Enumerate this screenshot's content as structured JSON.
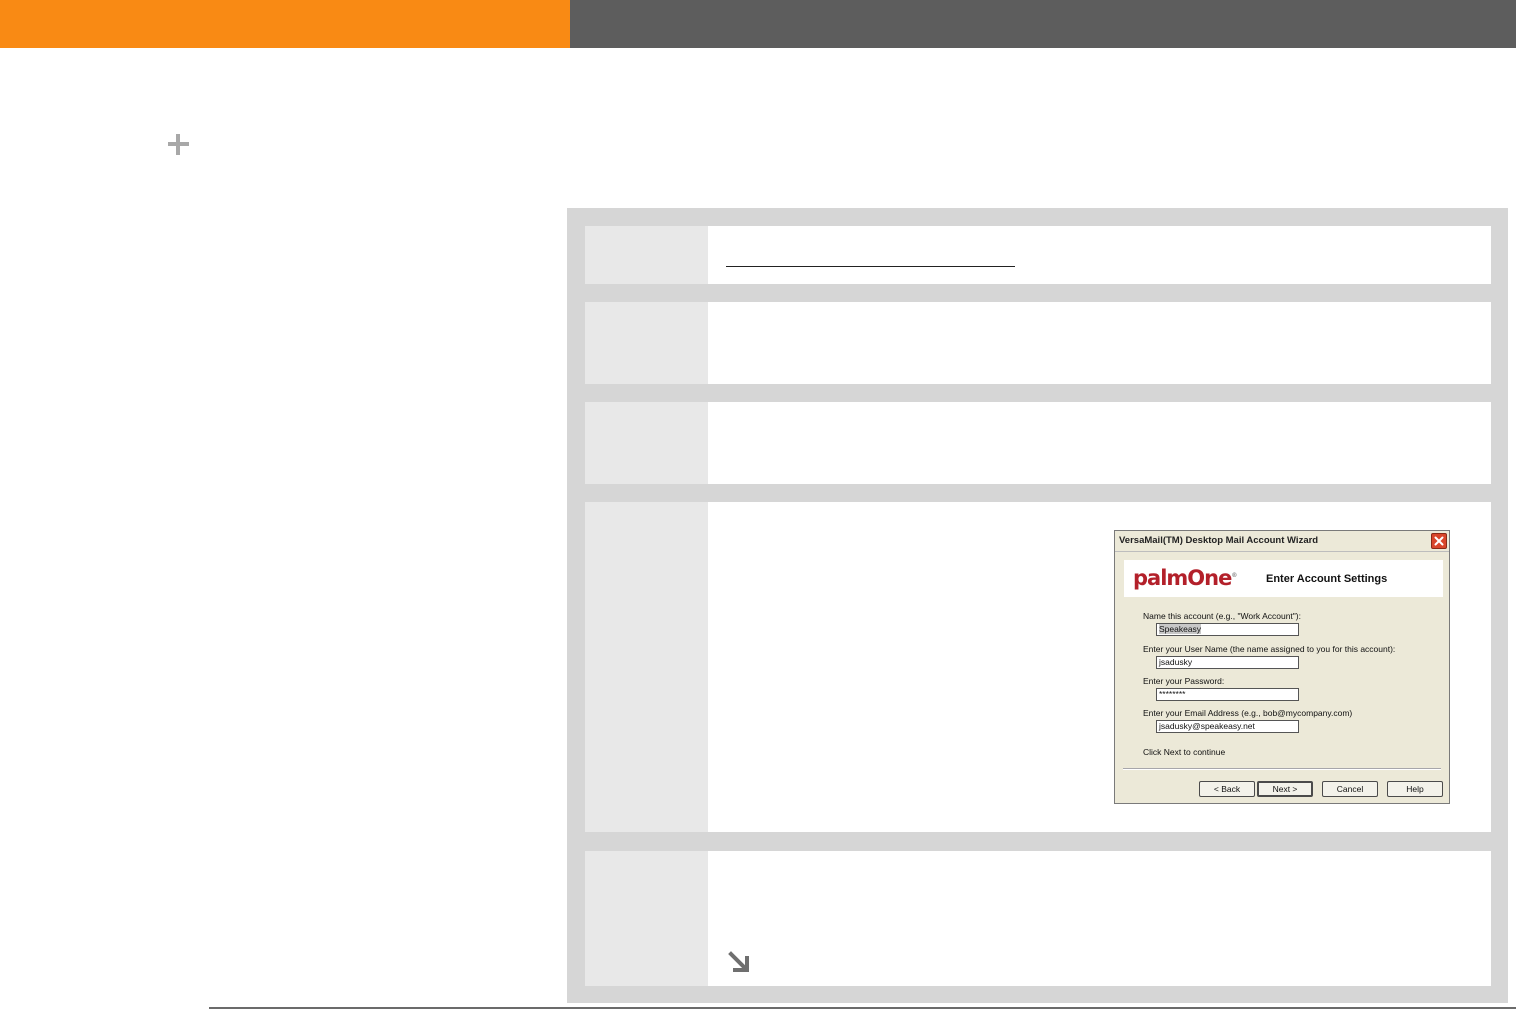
{
  "wizard": {
    "title": "VersaMail(TM) Desktop Mail Account Wizard",
    "logo": "palmOne",
    "header_title": "Enter Account Settings",
    "fields": [
      {
        "label": "Name this account (e.g., \"Work Account\"):",
        "value": "Speakeasy"
      },
      {
        "label": "Enter your User Name (the name assigned to you for this account):",
        "value": "jsadusky"
      },
      {
        "label": "Enter your Password:",
        "value": "********"
      },
      {
        "label": "Enter your Email Address (e.g., bob@mycompany.com)",
        "value": "jsadusky@speakeasy.net"
      }
    ],
    "instruction": "Click Next to continue",
    "buttons": {
      "back": "< Back",
      "next": "Next >",
      "cancel": "Cancel",
      "help": "Help"
    }
  },
  "colors": {
    "orange": "#f98a14",
    "dark_gray": "#5d5d5d",
    "panel_gray": "#d6d6d6",
    "step_gray": "#e8e8e8"
  }
}
